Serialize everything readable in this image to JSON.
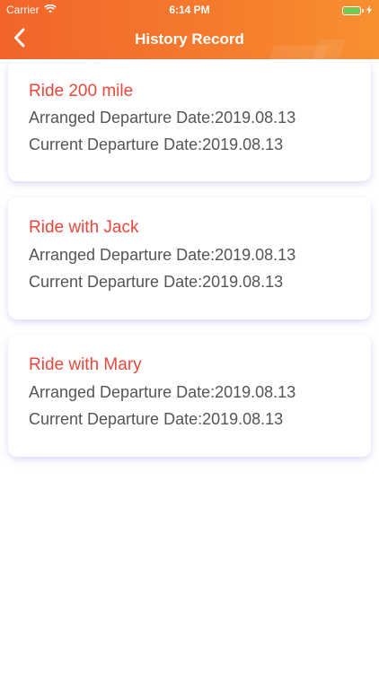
{
  "status_bar": {
    "carrier": "Carrier",
    "time": "6:14 PM",
    "battery_level": 1.0
  },
  "nav": {
    "title": "History Record",
    "back_icon": "chevron-left-icon"
  },
  "colors": {
    "header_start": "#f2642a",
    "header_end": "#f79030",
    "title_red": "#e8483c",
    "text_gray": "#555555"
  },
  "records": [
    {
      "title": "Ride 200 mile",
      "arranged": "Arranged Departure Date:2019.08.13",
      "current": "Current Departure Date:2019.08.13"
    },
    {
      "title": "Ride with Jack",
      "arranged": "Arranged Departure Date:2019.08.13",
      "current": "Current Departure Date:2019.08.13"
    },
    {
      "title": "Ride with Mary",
      "arranged": "Arranged Departure Date:2019.08.13",
      "current": "Current Departure Date:2019.08.13"
    }
  ]
}
